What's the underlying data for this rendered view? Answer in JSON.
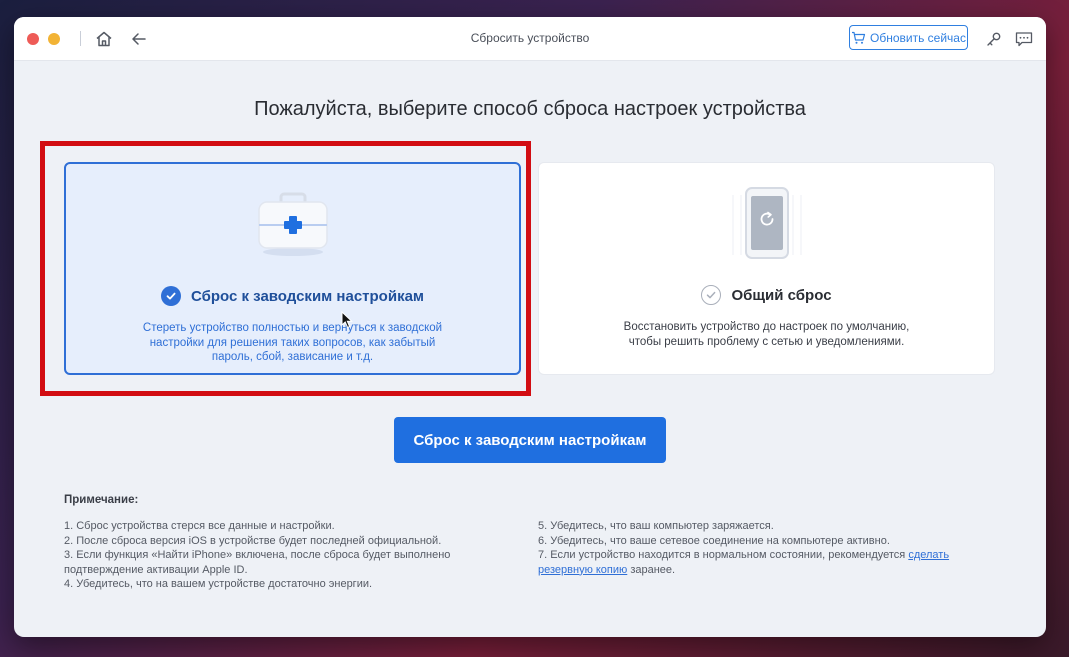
{
  "window": {
    "title": "Сбросить устройство",
    "buy_button": "Обновить сейчас"
  },
  "page": {
    "heading": "Пожалуйста, выберите способ сброса настроек устройства"
  },
  "options": [
    {
      "title": "Сброс к заводским настройкам",
      "description_lines": [
        "Стереть устройство полностью и вернуться к заводской",
        "настройки для решения таких вопросов, как забытый",
        "пароль, сбой, зависание и т.д."
      ],
      "selected": true,
      "icon": "first-aid-kit-icon"
    },
    {
      "title": "Общий сброс",
      "description_lines": [
        "Восстановить устройство до настроек по умолчанию,",
        "чтобы решить проблему с сетью и уведомлениями."
      ],
      "selected": false,
      "icon": "phone-refresh-icon"
    }
  ],
  "action_button": "Сброс к заводским настройкам",
  "notes": {
    "title": "Примечание:",
    "left": [
      "1. Сброс устройства стерся все данные и настройки.",
      "2. После сброса версия iOS в устройстве будет последней официальной.",
      "3. Если функция «Найти iPhone» включена, после сброса будет выполнено",
      "подтверждение активации Apple ID.",
      "4. Убедитесь, что на вашем устройстве достаточно энергии."
    ],
    "right": [
      "5. Убедитесь, что ваш компьютер заряжается.",
      "6. Убедитесь, что ваше сетевое соединение на компьютере активно.",
      "7. Если устройство находится в нормальном состоянии, рекомендуется"
    ],
    "link_part1": "сделать",
    "link_part2": "резервную копию",
    "after_link": " заранее."
  },
  "colors": {
    "accent": "#1f6fe0",
    "highlight_frame": "#d20d12",
    "selected_card_bg": "#e6eefc"
  }
}
